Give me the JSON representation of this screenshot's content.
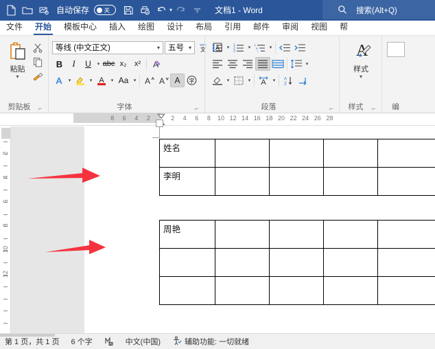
{
  "titlebar": {
    "icons": [
      "new-document-icon",
      "open-folder-icon",
      "touch-mode-icon"
    ],
    "autosave_label": "自动保存",
    "autosave_state": "关",
    "save_icon": "save-icon",
    "print_icon": "quick-print-icon",
    "undo_icon": "undo-icon",
    "redo_icon": "redo-icon",
    "customize_icon": "customize-qat-icon",
    "document_title": "文档1  -  Word",
    "search_placeholder": "搜索(Alt+Q)",
    "bg_color": "#2b579a",
    "search_bg_color": "#3c65a4"
  },
  "tabs": [
    {
      "label": "文件",
      "active": false
    },
    {
      "label": "开始",
      "active": true
    },
    {
      "label": "模板中心",
      "active": false
    },
    {
      "label": "插入",
      "active": false
    },
    {
      "label": "绘图",
      "active": false
    },
    {
      "label": "设计",
      "active": false
    },
    {
      "label": "布局",
      "active": false
    },
    {
      "label": "引用",
      "active": false
    },
    {
      "label": "邮件",
      "active": false
    },
    {
      "label": "审阅",
      "active": false
    },
    {
      "label": "视图",
      "active": false
    },
    {
      "label": "帮",
      "active": false
    }
  ],
  "ribbon": {
    "clipboard": {
      "group_label": "剪贴板",
      "paste_label": "粘贴",
      "cut_label": "剪切",
      "copy_label": "复制",
      "format_painter_label": "格式刷"
    },
    "font": {
      "group_label": "字体",
      "font_name": "等线 (中文正文)",
      "font_size": "五号",
      "bold": "B",
      "italic": "I",
      "underline": "U",
      "strikethrough": "abc",
      "subscript": "x₂",
      "superscript": "x²",
      "clear_format_label": "清除所有格式",
      "text_effects_label": "A",
      "highlight_label": "A",
      "font_color_label": "A",
      "change_case_label": "Aa",
      "grow_font": "A",
      "shrink_font": "A",
      "phonetic_guide": "wén文",
      "char_border": "A",
      "char_shading": "A",
      "enclose_char": "字"
    },
    "paragraph": {
      "group_label": "段落",
      "bullets_label": "项目符号",
      "numbering_label": "编号",
      "multilevel_label": "多级列表",
      "decrease_indent_label": "减少缩进量",
      "increase_indent_label": "增加缩进量",
      "align_left_label": "左对齐",
      "align_center_label": "居中",
      "align_right_label": "右对齐",
      "justify_label": "两端对齐",
      "distribute_label": "分散对齐",
      "line_spacing_label": "行和段落间距",
      "shading_label": "底纹",
      "borders_label": "边框",
      "sort_label": "排序",
      "show_marks_label": "显示编辑标记"
    },
    "styles": {
      "group_label": "样式",
      "button_label": "样式"
    }
  },
  "ruler": {
    "left_margin_numbers": [
      "8",
      "6",
      "4",
      "2"
    ],
    "numbers": [
      "2",
      "4",
      "6",
      "8",
      "10",
      "12",
      "14",
      "16",
      "18",
      "20",
      "22",
      "24",
      "26",
      "28"
    ],
    "vertical_numbers": [
      "2",
      "4",
      "6",
      "8",
      "10",
      "12"
    ]
  },
  "document": {
    "table1": {
      "rows": [
        [
          "姓名",
          "",
          "",
          "",
          ""
        ],
        [
          "李明",
          "",
          "",
          "",
          ""
        ]
      ]
    },
    "table2": {
      "rows": [
        [
          "周艳",
          "",
          "",
          "",
          ""
        ],
        [
          "",
          "",
          "",
          "",
          ""
        ],
        [
          "",
          "",
          "",
          "",
          ""
        ]
      ]
    },
    "annotations": [
      {
        "name": "red-arrow-table1",
        "color": "#f5333f"
      },
      {
        "name": "red-arrow-table2",
        "color": "#f5333f"
      }
    ]
  },
  "statusbar": {
    "page_info": "第 1 页，共 1 页",
    "word_count": "6 个字",
    "proofing_icon": "proofing-errors-icon",
    "language": "中文(中国)",
    "accessibility_icon": "accessibility-icon",
    "accessibility": "辅助功能: 一切就绪"
  }
}
